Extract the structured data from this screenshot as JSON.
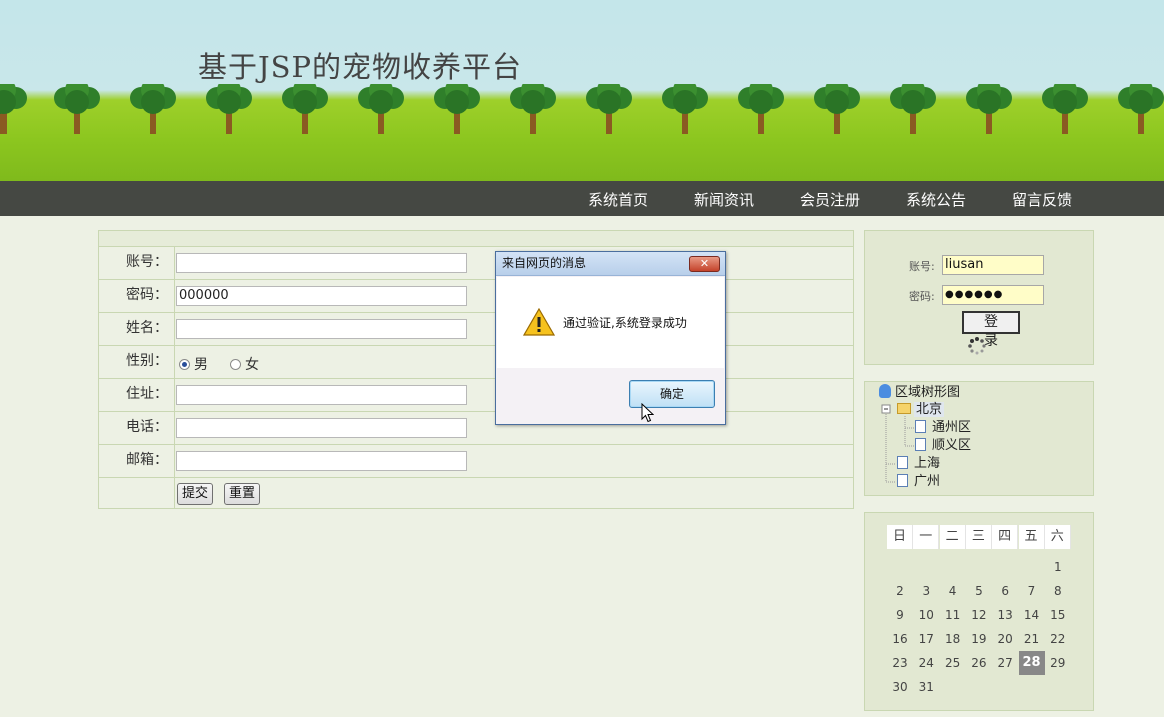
{
  "site": {
    "title": "基于JSP的宠物收养平台"
  },
  "nav": [
    "系统首页",
    "新闻资讯",
    "会员注册",
    "系统公告",
    "留言反馈"
  ],
  "form": {
    "account_label": "账号：",
    "password_label": "密码：",
    "password_value": "000000",
    "name_label": "姓名：",
    "gender_label": "性别：",
    "gender_male": "男",
    "gender_female": "女",
    "address_label": "住址：",
    "phone_label": "电话：",
    "email_label": "邮箱：",
    "submit_label": "提交",
    "reset_label": "重置"
  },
  "login": {
    "account_label": "账号:",
    "account_value": "liusan",
    "password_label": "密码:",
    "password_value": "●●●●●●",
    "button_label": "登 录"
  },
  "tree": {
    "root": "区域树形图",
    "beijing": "北京",
    "tongzhou": "通州区",
    "shunyi": "顺义区",
    "shanghai": "上海",
    "guangzhou": "广州"
  },
  "calendar": {
    "weekdays": [
      "日",
      "一",
      "二",
      "三",
      "四",
      "五",
      "六"
    ],
    "today": "28",
    "highlight_color": "#888888"
  },
  "dialog": {
    "title": "来自网页的消息",
    "close_symbol": "✕",
    "message": "通过验证,系统登录成功",
    "ok_label": "确定"
  }
}
